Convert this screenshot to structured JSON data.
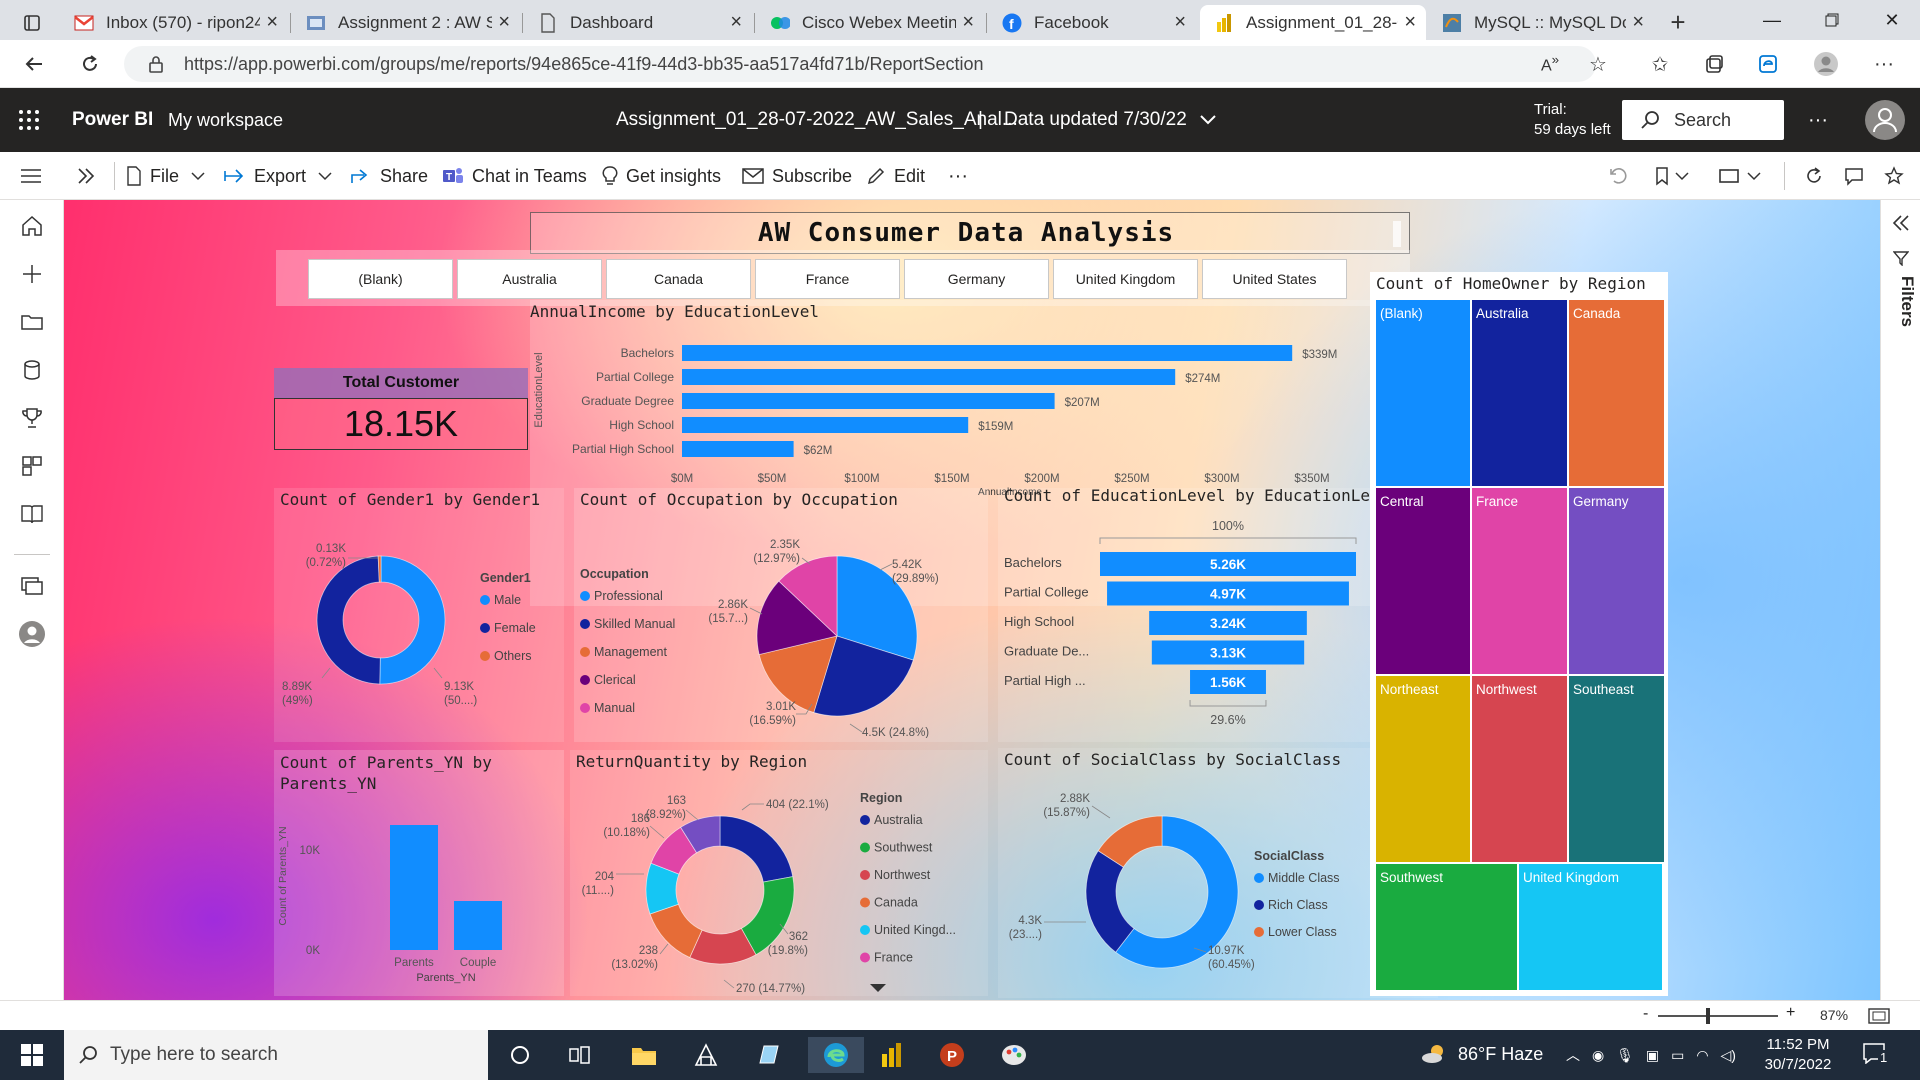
{
  "browser": {
    "tabs": [
      {
        "label": "Inbox (570) - ripon24..."
      },
      {
        "label": "Assignment 2 : AW Sa..."
      },
      {
        "label": "Dashboard"
      },
      {
        "label": "Cisco Webex Meeting..."
      },
      {
        "label": "Facebook"
      },
      {
        "label": "Assignment_01_28-07..."
      },
      {
        "label": "MySQL :: MySQL Dow..."
      }
    ],
    "url": "https://app.powerbi.com/groups/me/reports/94e865ce-41f9-44d3-bb35-aa517a4fd71b/ReportSection"
  },
  "header": {
    "brand": "Power BI",
    "workspace": "My workspace",
    "report_name": "Assignment_01_28-07-2022_AW_Sales_Anal...",
    "separator": "|",
    "data_updated": "Data updated 7/30/22",
    "trial_line1": "Trial:",
    "trial_line2": "59 days left",
    "search_placeholder": "Search"
  },
  "toolbar": {
    "file": "File",
    "export": "Export",
    "share": "Share",
    "chat_in_teams": "Chat in Teams",
    "get_insights": "Get insights",
    "subscribe": "Subscribe",
    "edit": "Edit",
    "more": "···"
  },
  "filters_label": "Filters",
  "report": {
    "title": "AW Consumer Data Analysis",
    "slicer": [
      "(Blank)",
      "Australia",
      "Canada",
      "France",
      "Germany",
      "United Kingdom",
      "United States"
    ],
    "card": {
      "label": "Total Customer",
      "value": "18.15K"
    }
  },
  "chart_data": [
    {
      "id": "income",
      "type": "bar",
      "title": "AnnualIncome by EducationLevel",
      "xlabel": "AnnualIncome",
      "ylabel": "EducationLevel",
      "categories": [
        "Bachelors",
        "Partial College",
        "Graduate Degree",
        "High School",
        "Partial High School"
      ],
      "values": [
        339,
        274,
        207,
        159,
        62
      ],
      "labels": [
        "$339M",
        "$274M",
        "$207M",
        "$159M",
        "$62M"
      ],
      "ticks": [
        "$0M",
        "$50M",
        "$100M",
        "$150M",
        "$200M",
        "$250M",
        "$300M",
        "$350M"
      ],
      "xlim": [
        0,
        350
      ],
      "color": "#118dff"
    },
    {
      "id": "gender",
      "type": "pie",
      "variant": "donut",
      "title": "Count of Gender1 by Gender1",
      "legend_title": "Gender1",
      "legend": [
        "Male",
        "Female",
        "Others"
      ],
      "values": [
        9.13,
        8.89,
        0.13
      ],
      "labels": [
        [
          "9.13K",
          "(50....)"
        ],
        [
          "8.89K",
          "(49%)"
        ],
        [
          "0.13K",
          "(0.72%)"
        ]
      ],
      "colors": [
        "#118dff",
        "#12239e",
        "#e66c37"
      ]
    },
    {
      "id": "occupation",
      "type": "pie",
      "title": "Count of Occupation by Occupation",
      "legend_title": "Occupation",
      "legend": [
        "Professional",
        "Skilled Manual",
        "Management",
        "Clerical",
        "Manual"
      ],
      "values": [
        5.42,
        4.5,
        3.01,
        2.86,
        2.35
      ],
      "labels": [
        [
          "5.42K",
          "(29.89%)"
        ],
        [
          "4.5K (24.8%)"
        ],
        [
          "3.01K",
          "(16.59%)"
        ],
        [
          "2.86K",
          "(15.7...)"
        ],
        [
          "2.35K",
          "(12.97%)"
        ]
      ],
      "colors": [
        "#118dff",
        "#12239e",
        "#e66c37",
        "#6b007b",
        "#e044a7"
      ]
    },
    {
      "id": "funnel",
      "type": "bar",
      "variant": "funnel",
      "title": "Count of EducationLevel by EducationLevel",
      "top_label": "100%",
      "bottom_label": "29.6%",
      "categories": [
        "Bachelors",
        "Partial College",
        "High School",
        "Graduate De...",
        "Partial High ..."
      ],
      "values": [
        5.26,
        4.97,
        3.24,
        3.13,
        1.56
      ],
      "labels": [
        "5.26K",
        "4.97K",
        "3.24K",
        "3.13K",
        "1.56K"
      ],
      "color": "#118dff"
    },
    {
      "id": "parents",
      "type": "bar",
      "title": "Count of Parents_YN by Parents_YN",
      "xlabel": "Parents_YN",
      "ylabel": "Count of Parents_YN",
      "categories": [
        "Parents",
        "Couple"
      ],
      "values": [
        12500,
        4900
      ],
      "ticks": [
        "0K",
        "10K"
      ],
      "ylim": [
        0,
        15000
      ],
      "color": "#118dff"
    },
    {
      "id": "returns",
      "type": "pie",
      "variant": "donut",
      "title": "ReturnQuantity by Region",
      "legend_title": "Region",
      "legend": [
        "Australia",
        "Southwest",
        "Northwest",
        "Canada",
        "United Kingd...",
        "France"
      ],
      "slices": [
        {
          "value": 404,
          "color": "#12239e"
        },
        {
          "value": 362,
          "color": "#1aab40"
        },
        {
          "value": 270,
          "color": "#d64550"
        },
        {
          "value": 238,
          "color": "#e66c37"
        },
        {
          "value": 204,
          "color": "#15c6f4"
        },
        {
          "value": 186,
          "color": "#e044a7"
        },
        {
          "value": 163,
          "color": "#744ec2"
        }
      ],
      "labels": [
        [
          "404 (22.1%)"
        ],
        [
          "362",
          "(19.8%)"
        ],
        [
          "270 (14.77%)"
        ],
        [
          "238",
          "(13.02%)"
        ],
        [
          "204",
          "(11....)"
        ],
        [
          "186",
          "(10.18%)"
        ],
        [
          "163",
          "(8.92%)"
        ]
      ],
      "legend_colors": [
        "#12239e",
        "#1aab40",
        "#d64550",
        "#e66c37",
        "#15c6f4",
        "#e044a7"
      ]
    },
    {
      "id": "social",
      "type": "pie",
      "variant": "donut",
      "title": "Count of SocialClass by SocialClass",
      "legend_title": "SocialClass",
      "legend": [
        "Middle Class",
        "Rich Class",
        "Lower Class"
      ],
      "values": [
        10.97,
        4.3,
        2.88
      ],
      "labels": [
        [
          "10.97K",
          "(60.45%)"
        ],
        [
          "4.3K",
          "(23....)"
        ],
        [
          "2.88K",
          "(15.87%)"
        ]
      ],
      "colors": [
        "#118dff",
        "#12239e",
        "#e66c37"
      ]
    }
  ],
  "treemap": {
    "title": "Count of HomeOwner by Region",
    "cells": [
      {
        "label": "(Blank)",
        "color": "#118dff"
      },
      {
        "label": "Australia",
        "color": "#12239e"
      },
      {
        "label": "Canada",
        "color": "#e66c37"
      },
      {
        "label": "Central",
        "color": "#6b007b"
      },
      {
        "label": "France",
        "color": "#e044a7"
      },
      {
        "label": "Germany",
        "color": "#744ec2"
      },
      {
        "label": "Northeast",
        "color": "#d9b300"
      },
      {
        "label": "Northwest",
        "color": "#d64550"
      },
      {
        "label": "Southeast",
        "color": "#197278"
      },
      {
        "label": "Southwest",
        "color": "#1aab40"
      },
      {
        "label": "United Kingdom",
        "color": "#15c6f4"
      }
    ]
  },
  "status": {
    "zoom": "87%"
  },
  "taskbar": {
    "search_placeholder": "Type here to search",
    "weather": "86°F  Haze",
    "time": "11:52 PM",
    "date": "30/7/2022",
    "notification_count": "1"
  }
}
